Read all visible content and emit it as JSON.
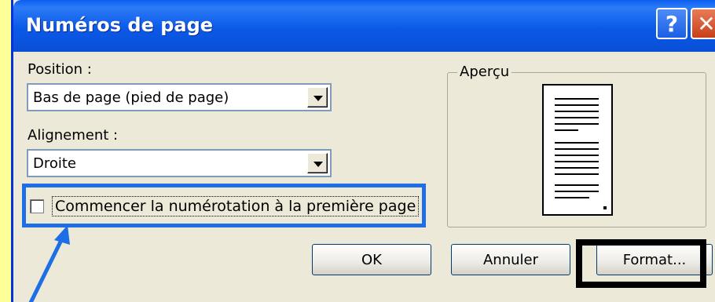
{
  "window": {
    "title": "Numéros de page",
    "help_label": "?",
    "close_label": "✕"
  },
  "position": {
    "label": "Position :",
    "value": "Bas de page (pied de page)"
  },
  "alignment": {
    "label": "Alignement :",
    "value": "Droite"
  },
  "checkbox": {
    "label": "Commencer la numérotation à la première page",
    "checked": false
  },
  "preview": {
    "title": "Aperçu"
  },
  "buttons": {
    "ok": "OK",
    "cancel": "Annuler",
    "format": "Format..."
  },
  "colors": {
    "titlebar": "#0a5ef0",
    "highlight_blue": "#1e6fe6",
    "highlight_black": "#000000",
    "background": "#ffff99"
  }
}
